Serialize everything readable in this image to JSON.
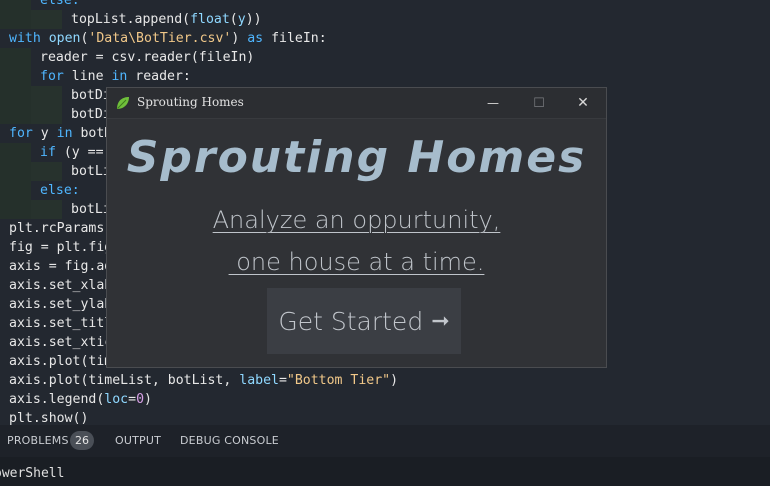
{
  "editor": {
    "lines": [
      {
        "indent": 1,
        "parts": [
          [
            "kw",
            "else:"
          ]
        ]
      },
      {
        "indent": 2,
        "parts": [
          [
            "fn",
            "topList.append("
          ],
          [
            "var",
            "float"
          ],
          [
            "fn",
            "("
          ],
          [
            "var",
            "y"
          ],
          [
            "fn",
            "))"
          ]
        ]
      },
      {
        "indent": 0,
        "parts": [
          [
            "kw",
            "with "
          ],
          [
            "var",
            "open"
          ],
          [
            "fn",
            "("
          ],
          [
            "str",
            "'Data\\BotTier.csv'"
          ],
          [
            "fn",
            ") "
          ],
          [
            "kw",
            "as"
          ],
          [
            "fn",
            " fileIn:"
          ]
        ]
      },
      {
        "indent": 1,
        "parts": [
          [
            "fn",
            "reader = csv.reader(fileIn)"
          ]
        ]
      },
      {
        "indent": 1,
        "parts": [
          [
            "kw",
            "for"
          ],
          [
            "fn",
            " line "
          ],
          [
            "kw",
            "in"
          ],
          [
            "fn",
            " reader:"
          ]
        ]
      },
      {
        "indent": 2,
        "parts": [
          [
            "fn",
            "botDi"
          ]
        ]
      },
      {
        "indent": 2,
        "parts": [
          [
            "fn",
            "botDi"
          ]
        ]
      },
      {
        "indent": 0,
        "parts": [
          [
            "kw",
            "for"
          ],
          [
            "fn",
            " y "
          ],
          [
            "kw",
            "in"
          ],
          [
            "fn",
            " botD"
          ]
        ]
      },
      {
        "indent": 1,
        "parts": [
          [
            "kw",
            "if"
          ],
          [
            "fn",
            " (y =="
          ]
        ]
      },
      {
        "indent": 2,
        "parts": [
          [
            "fn",
            "botLi"
          ]
        ]
      },
      {
        "indent": 1,
        "parts": [
          [
            "kw",
            "else:"
          ]
        ]
      },
      {
        "indent": 2,
        "parts": [
          [
            "fn",
            "botLi"
          ]
        ]
      },
      {
        "indent": 0,
        "parts": [
          [
            "fn",
            "plt.rcParams["
          ]
        ]
      },
      {
        "indent": 0,
        "parts": [
          [
            "fn",
            "fig = plt.fig"
          ]
        ]
      },
      {
        "indent": 0,
        "parts": [
          [
            "fn",
            "axis = fig.ad"
          ]
        ]
      },
      {
        "indent": 0,
        "parts": [
          [
            "fn",
            "axis.set_xlab"
          ]
        ]
      },
      {
        "indent": 0,
        "parts": [
          [
            "fn",
            "axis.set_ylab"
          ]
        ]
      },
      {
        "indent": 0,
        "parts": [
          [
            "fn",
            "axis.set_titl"
          ]
        ]
      },
      {
        "indent": 0,
        "parts": [
          [
            "fn",
            "axis.set_xtic"
          ]
        ]
      },
      {
        "indent": 0,
        "parts": [
          [
            "fn",
            "axis.plot(tim"
          ]
        ]
      },
      {
        "indent": 0,
        "parts": [
          [
            "fn",
            "axis.plot(timeList, botList, "
          ],
          [
            "var",
            "label"
          ],
          [
            "fn",
            "="
          ],
          [
            "str",
            "\"Bottom Tier\""
          ],
          [
            "fn",
            ")"
          ]
        ]
      },
      {
        "indent": 0,
        "parts": [
          [
            "fn",
            "axis.legend("
          ],
          [
            "var",
            "loc"
          ],
          [
            "fn",
            "="
          ],
          [
            "num",
            "0"
          ],
          [
            "fn",
            ")"
          ]
        ]
      },
      {
        "indent": 0,
        "parts": [
          [
            "fn",
            "plt.show()"
          ]
        ]
      }
    ]
  },
  "panel": {
    "tabs": [
      "PROBLEMS",
      "OUTPUT",
      "DEBUG CONSOLE"
    ],
    "problems_count": "26",
    "terminal_label": "owerShell"
  },
  "window": {
    "title": "Sprouting Homes",
    "minimize_glyph": "—",
    "maximize_glyph": "☐",
    "close_glyph": "✕"
  },
  "hero": {
    "title": "Sprouting Homes",
    "tagline_line1": "Analyze an oppurtunity,",
    "tagline_line2": " one house at a time.",
    "cta_label": "Get Started",
    "cta_arrow": "➞"
  },
  "colors": {
    "accent": "#a6bccc",
    "leaf_green": "#6fbf3b"
  }
}
